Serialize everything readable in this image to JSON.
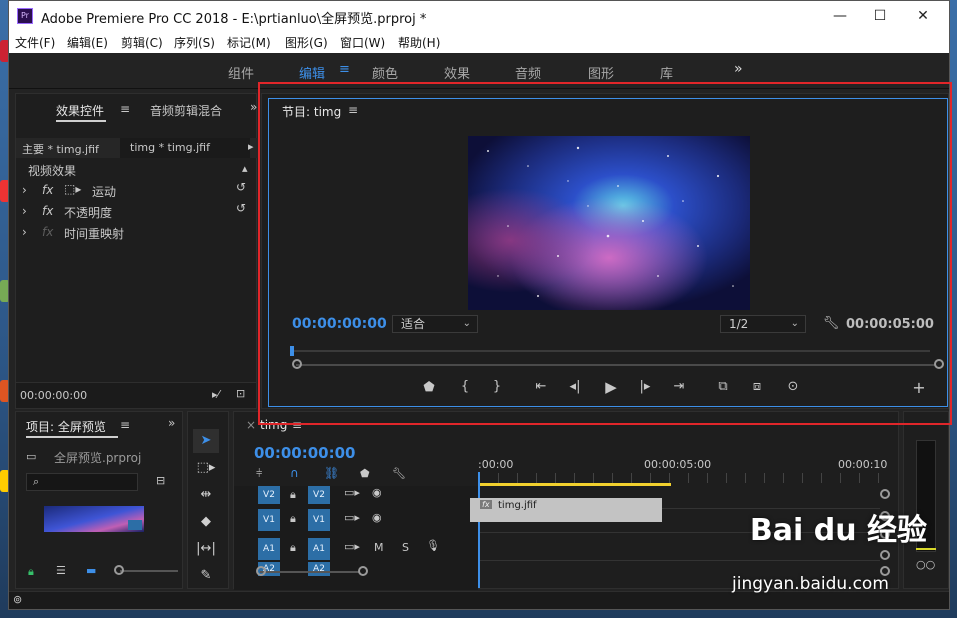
{
  "window": {
    "logo_text": "Pr",
    "title": "Adobe Premiere Pro CC 2018 - E:\\prtianluo\\全屏预览.prproj *",
    "minimize": "—",
    "maximize": "☐",
    "close": "✕"
  },
  "menu": [
    "文件(F)",
    "编辑(E)",
    "剪辑(C)",
    "序列(S)",
    "标记(M)",
    "图形(G)",
    "窗口(W)",
    "帮助(H)"
  ],
  "workspaces": {
    "items": [
      "组件",
      "编辑",
      "颜色",
      "效果",
      "音频",
      "图形",
      "库"
    ],
    "active": "编辑",
    "menu_glyph": "≡",
    "more_glyph": "»"
  },
  "effects_panel": {
    "tab_effects": "效果控件",
    "tab_menu": "≡",
    "tab_audio": "音频剪辑混合",
    "more": "»",
    "master_label": "主要 * timg.jfif",
    "clip_label": "timg * timg.jfif",
    "section": "视频效果",
    "effects": [
      {
        "name": "运动",
        "fx": "fx"
      },
      {
        "name": "不透明度",
        "fx": "fx"
      },
      {
        "name": "时间重映射",
        "fx": "fx"
      }
    ],
    "timecode": "00:00:00:00"
  },
  "program_monitor": {
    "title": "节目: timg",
    "menu": "≡",
    "timecode": "00:00:00:00",
    "fit": "适合",
    "resolution": "1/2",
    "duration": "00:00:05:00"
  },
  "project_panel": {
    "title": "项目: 全屏预览",
    "menu": "≡",
    "more": "»",
    "file": "全屏预览.prproj",
    "search_placeholder": "",
    "search_icon": "⌕"
  },
  "timeline": {
    "close": "×",
    "title": "timg",
    "menu": "≡",
    "timecode": "00:00:00:00",
    "ruler": [
      ":00:00",
      "00:00:05:00",
      "00:00:10"
    ],
    "tracks": [
      {
        "id": "V2",
        "src": "V2"
      },
      {
        "id": "V1",
        "src": "V1"
      },
      {
        "id": "A1",
        "src": "A1"
      },
      {
        "id": "A2",
        "src": "A2"
      }
    ],
    "clip_name": "timg.jfif",
    "clip_fx": "fx",
    "track_m": "M",
    "track_s": "S"
  },
  "watermark": {
    "brand": "Bai du 经验",
    "url": "jingyan.baidu.com"
  },
  "colors": {
    "accent": "#3d8fe8",
    "highlight_box": "#e0262a",
    "panel_bg": "#1e1e1e"
  }
}
